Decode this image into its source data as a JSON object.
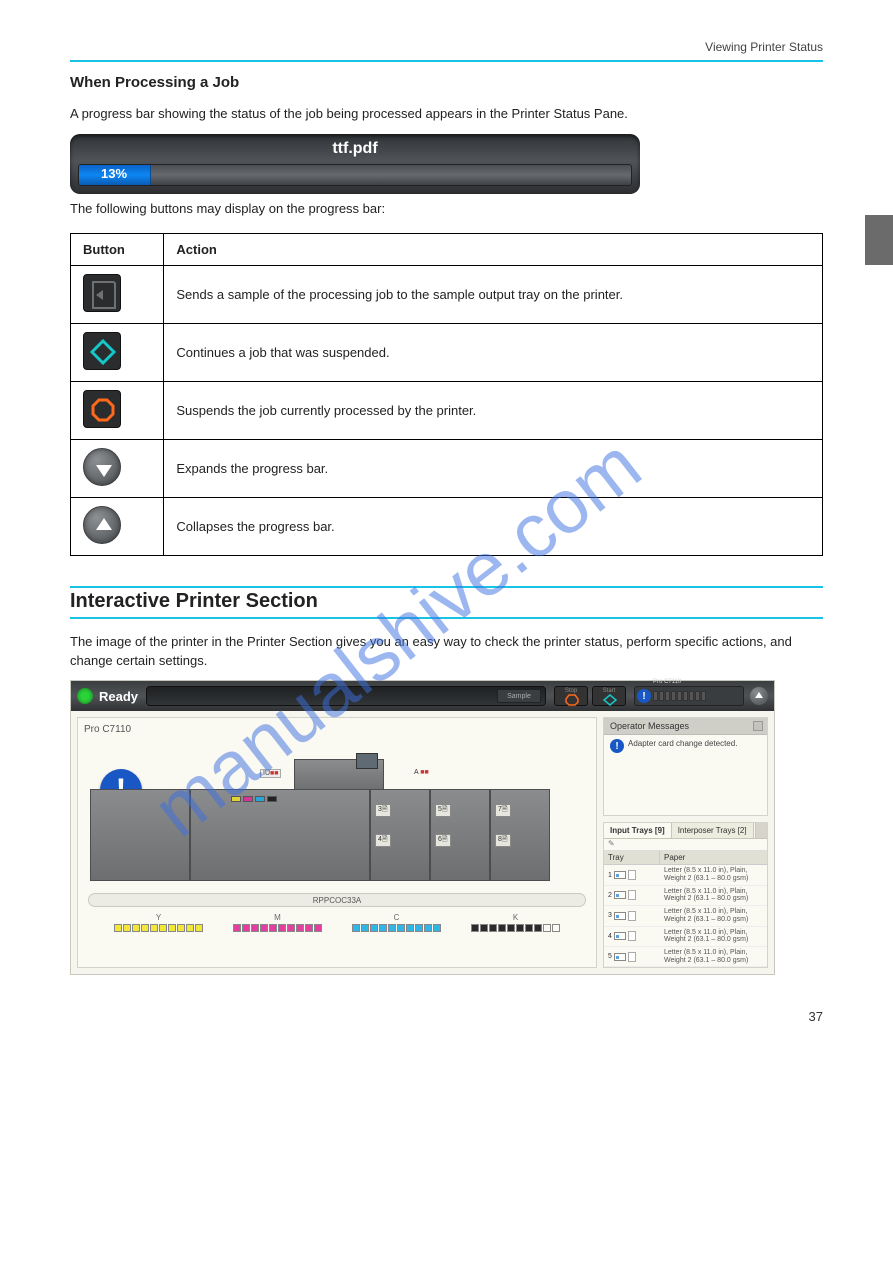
{
  "header_right": "Viewing Printer Status",
  "section1": {
    "title": "When Processing a Job",
    "para": "A progress bar showing the status of the job being processed appears in the Printer Status Pane.",
    "progress": {
      "filename": "ttf.pdf",
      "percent": 13,
      "percent_label": "13%"
    },
    "intro_table": "The following buttons may display on the progress bar:",
    "table": {
      "headers": [
        "Button",
        "Action"
      ],
      "rows": [
        {
          "key": "sample",
          "action": "Sends a sample of the processing job to the sample output tray on the printer."
        },
        {
          "key": "start",
          "action": "Continues a job that was suspended."
        },
        {
          "key": "stop",
          "action": "Suspends the job currently processed by the printer."
        },
        {
          "key": "expand",
          "action": "Expands the progress bar."
        },
        {
          "key": "collapse",
          "action": "Collapses the progress bar."
        }
      ]
    }
  },
  "section2": {
    "title": "Interactive Printer Section",
    "para": "The image of the printer in the Printer Section gives you an easy way to check the printer status, perform specific actions, and change certain settings.",
    "screenshot": {
      "status_text": "Ready",
      "buttons": {
        "sample": "Sample",
        "stop": "Stop",
        "start": "Start"
      },
      "context_label": "Pro C7110",
      "left_card": {
        "title": "Pro C7110",
        "iu_label": "IU",
        "a_label": "A",
        "model_bar": "RPPCOC33A",
        "tray_badges": [
          "3",
          "5",
          "7",
          "4",
          "6",
          "8"
        ],
        "toners": [
          {
            "label": "Y",
            "color": "#f2e63a"
          },
          {
            "label": "M",
            "color": "#e23fa0"
          },
          {
            "label": "C",
            "color": "#2fb6e6"
          },
          {
            "label": "K",
            "color": "#2a2a2a"
          }
        ]
      },
      "operator": {
        "header": "Operator Messages",
        "message": "Adapter card change detected."
      },
      "trays": {
        "tabs": [
          "Input Trays [9]",
          "Interposer Trays [2]"
        ],
        "pencil": "✎",
        "headers": [
          "Tray",
          "Paper"
        ],
        "rows": [
          {
            "n": "1",
            "paper": "Letter (8.5 x 11.0 in), Plain, Weight 2 (63.1 – 80.0 gsm)"
          },
          {
            "n": "2",
            "paper": "Letter (8.5 x 11.0 in), Plain, Weight 2 (63.1 – 80.0 gsm)"
          },
          {
            "n": "3",
            "paper": "Letter (8.5 x 11.0 in), Plain, Weight 2 (63.1 – 80.0 gsm)"
          },
          {
            "n": "4",
            "paper": "Letter (8.5 x 11.0 in), Plain, Weight 2 (63.1 – 80.0 gsm)"
          },
          {
            "n": "5",
            "paper": "Letter (8.5 x 11.0 in), Plain, Weight 2 (63.1 – 80.0 gsm)"
          }
        ]
      }
    }
  },
  "footer_page": "37",
  "watermark": "manualshive.com"
}
